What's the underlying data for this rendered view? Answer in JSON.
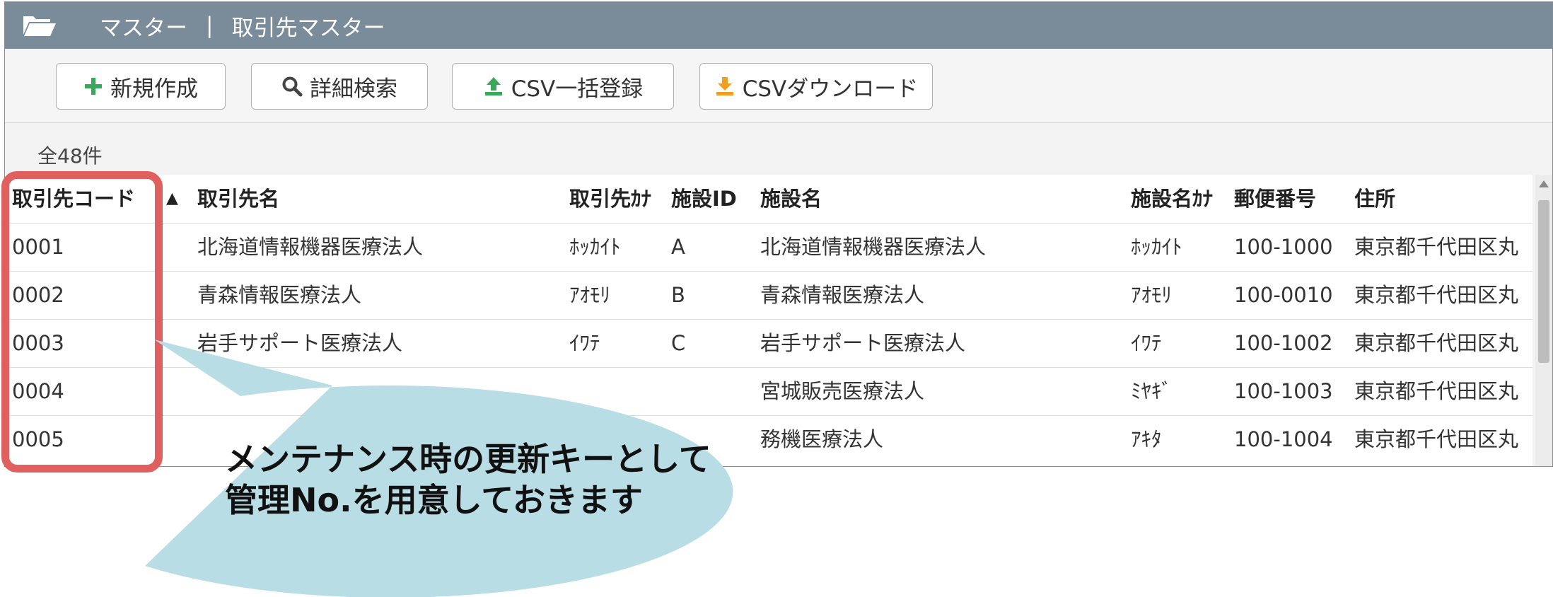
{
  "titlebar": {
    "icon": "folder-open-icon",
    "section": "マスター",
    "separator": "|",
    "page": "取引先マスター"
  },
  "toolbar": {
    "new_label": "新規作成",
    "search_label": "詳細検索",
    "csv_upload_label": "CSV一括登録",
    "csv_download_label": "CSVダウンロード"
  },
  "summary": {
    "count": "全48件"
  },
  "table": {
    "headers": [
      "取引先コード",
      "取引先名",
      "取引先ｶﾅ",
      "施設ID",
      "施設名",
      "施設名ｶﾅ",
      "郵便番号",
      "住所"
    ],
    "sort_indicator": "▲",
    "rows": [
      [
        "0001",
        "北海道情報機器医療法人",
        "ﾎｯｶｲﾄ",
        "A",
        "北海道情報機器医療法人",
        "ﾎｯｶｲﾄ",
        "100-1000",
        "東京都千代田区丸"
      ],
      [
        "0002",
        "青森情報医療法人",
        "ｱｵﾓﾘ",
        "B",
        "青森情報医療法人",
        "ｱｵﾓﾘ",
        "100-0010",
        "東京都千代田区丸"
      ],
      [
        "0003",
        "岩手サポート医療法人",
        "ｲﾜﾃ",
        "C",
        "岩手サポート医療法人",
        "ｲﾜﾃ",
        "100-1002",
        "東京都千代田区丸"
      ],
      [
        "0004",
        "",
        "",
        "",
        "宮城販売医療法人",
        "ﾐﾔｷﾞ",
        "100-1003",
        "東京都千代田区丸"
      ],
      [
        "0005",
        "",
        "",
        "",
        "務機医療法人",
        "ｱｷﾀ",
        "100-1004",
        "東京都千代田区丸"
      ]
    ]
  },
  "callout": {
    "line1": "メンテナンス時の更新キーとして",
    "line2": "管理No.を用意しておきます",
    "highlight_color": "#e06060",
    "bubble_color": "#b9dde4"
  },
  "colors": {
    "titlebar": "#7a8b9a",
    "plus_icon": "#3aa85a",
    "upload_icon": "#3aa85a",
    "download_icon": "#f0a020"
  }
}
